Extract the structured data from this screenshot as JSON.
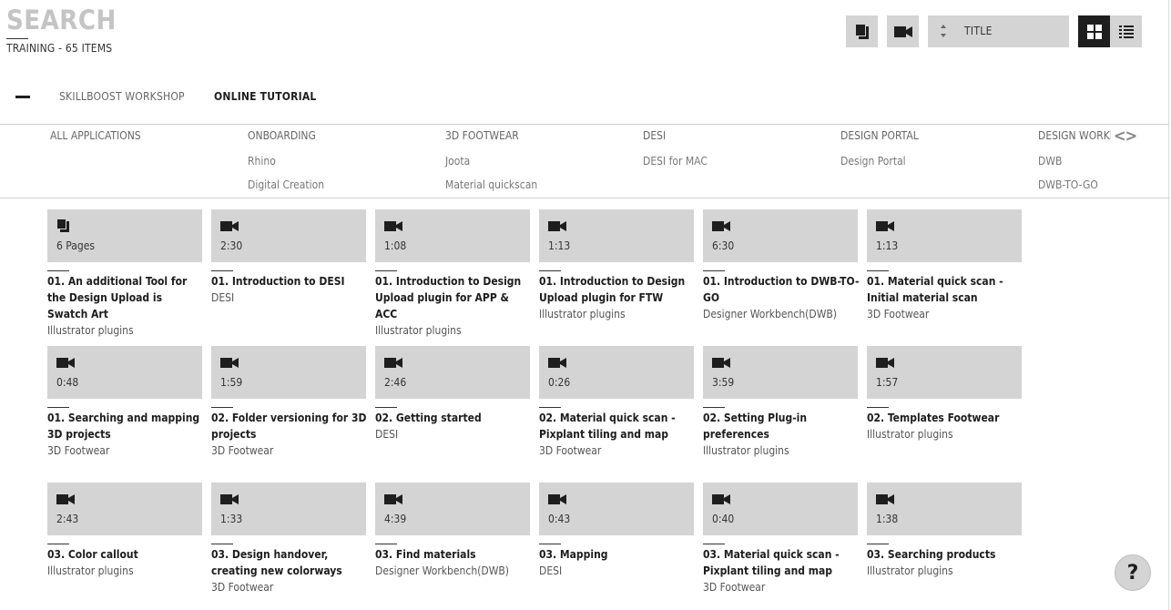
{
  "header": {
    "title": "SEARCH",
    "subtitle": "TRAINING - 65 ITEMS"
  },
  "toolbar": {
    "sort_label": "TITLE",
    "view": "grid"
  },
  "tabs": [
    {
      "label": "SKILLBOOST WORKSHOP",
      "active": false
    },
    {
      "label": "ONLINE TUTORIAL",
      "active": true
    }
  ],
  "filters": [
    {
      "head": "ALL APPLICATIONS",
      "items": []
    },
    {
      "head": "ONBOARDING",
      "items": [
        "Rhino",
        "Digital Creation"
      ]
    },
    {
      "head": "3D FOOTWEAR",
      "items": [
        "Joota",
        "Material quickscan"
      ]
    },
    {
      "head": "DESI",
      "items": [
        "DESI for MAC"
      ]
    },
    {
      "head": "DESIGN PORTAL",
      "items": [
        "Design Portal"
      ]
    },
    {
      "head": "DESIGN WORKBENCH",
      "items": [
        "DWB",
        "DWB-TO-GO"
      ]
    }
  ],
  "filter_nav": {
    "prev": "<",
    "next": ">"
  },
  "cards": [
    {
      "type": "book",
      "duration": "6 Pages",
      "title": "01. An additional Tool for the Design Upload is Swatch Art",
      "category": "Illustrator plugins"
    },
    {
      "type": "video",
      "duration": "2:30",
      "title": "01. Introduction to DESI",
      "category": "DESI"
    },
    {
      "type": "video",
      "duration": "1:08",
      "title": "01. Introduction to Design Upload plugin for APP & ACC",
      "category": "Illustrator plugins"
    },
    {
      "type": "video",
      "duration": "1:13",
      "title": "01. Introduction to Design Upload plugin for FTW",
      "category": "Illustrator plugins"
    },
    {
      "type": "video",
      "duration": "6:30",
      "title": "01. Introduction to DWB-TO-GO",
      "category": "Designer Workbench(DWB)"
    },
    {
      "type": "video",
      "duration": "1:13",
      "title": "01. Material quick scan - Initial material scan",
      "category": "3D Footwear"
    },
    {
      "type": "video",
      "duration": "0:48",
      "title": "01. Searching and mapping 3D projects",
      "category": "3D Footwear"
    },
    {
      "type": "video",
      "duration": "1:59",
      "title": "02. Folder versioning for 3D projects",
      "category": "3D Footwear"
    },
    {
      "type": "video",
      "duration": "2:46",
      "title": "02. Getting started",
      "category": "DESI"
    },
    {
      "type": "video",
      "duration": "0:26",
      "title": "02. Material quick scan - Pixplant tiling and map",
      "category": "3D Footwear"
    },
    {
      "type": "video",
      "duration": "3:59",
      "title": "02. Setting Plug-in preferences",
      "category": "Illustrator plugins"
    },
    {
      "type": "video",
      "duration": "1:57",
      "title": "02. Templates Footwear",
      "category": "Illustrator plugins"
    },
    {
      "type": "video",
      "duration": "2:43",
      "title": "03. Color callout",
      "category": "Illustrator plugins"
    },
    {
      "type": "video",
      "duration": "1:33",
      "title": "03. Design handover, creating new colorways",
      "category": "3D Footwear"
    },
    {
      "type": "video",
      "duration": "4:39",
      "title": "03. Find materials",
      "category": "Designer Workbench(DWB)"
    },
    {
      "type": "video",
      "duration": "0:43",
      "title": "03. Mapping",
      "category": "DESI"
    },
    {
      "type": "video",
      "duration": "0:40",
      "title": "03. Material quick scan - Pixplant tiling and map",
      "category": "3D Footwear"
    },
    {
      "type": "video",
      "duration": "1:38",
      "title": "03. Searching products",
      "category": "Illustrator plugins"
    }
  ],
  "help": {
    "label": "?"
  },
  "colors": {
    "tile": "#d4d4d4",
    "dark": "#1e1e1e",
    "muted": "#c4c4c4"
  }
}
